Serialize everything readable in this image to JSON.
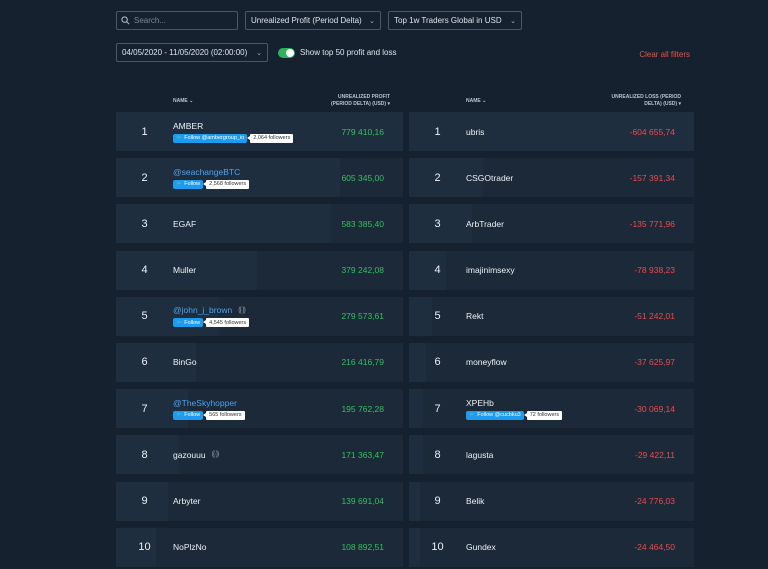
{
  "filters": {
    "search_placeholder": "Search...",
    "metric": "Unrealized Profit (Period Delta)",
    "group": "Top 1w Traders Global in USD",
    "date_range": "04/05/2020 - 11/05/2020 (02:00:00)",
    "toggle_label": "Show top 50 profit and loss",
    "clear_label": "Clear all filters"
  },
  "profit": {
    "col_name": "NAME",
    "col_value_1": "UNREALIZED PROFIT",
    "col_value_2": "(PERIOD DELTA) (USD)",
    "rows": [
      {
        "rank": "1",
        "name": "AMBER",
        "value": "779 410,16",
        "follow": "Follow @ambergroup_io",
        "followers": "2,064 followers",
        "live": "",
        "handle": false,
        "level": 1.0
      },
      {
        "rank": "2",
        "name": "@seachangeBTC",
        "value": "605 345,00",
        "follow": "Follow",
        "followers": "2,568 followers",
        "live": "",
        "handle": true,
        "level": 0.78
      },
      {
        "rank": "3",
        "name": "EGAF",
        "value": "583 385,40",
        "follow": "",
        "followers": "",
        "live": "",
        "handle": false,
        "level": 0.75
      },
      {
        "rank": "4",
        "name": "Muller",
        "value": "379 242,08",
        "follow": "",
        "followers": "",
        "live": "",
        "handle": false,
        "level": 0.49
      },
      {
        "rank": "5",
        "name": "@john_j_brown",
        "value": "279 573,61",
        "follow": "Follow",
        "followers": "4,545 followers",
        "live": "((·))",
        "handle": true,
        "level": 0.36
      },
      {
        "rank": "6",
        "name": "BinGo",
        "value": "216 416,79",
        "follow": "",
        "followers": "",
        "live": "",
        "handle": false,
        "level": 0.28
      },
      {
        "rank": "7",
        "name": "@TheSkyhopper",
        "value": "195 762,28",
        "follow": "Follow",
        "followers": "565 followers",
        "live": "",
        "handle": true,
        "level": 0.25
      },
      {
        "rank": "8",
        "name": "gazouuu",
        "value": "171 363,47",
        "follow": "",
        "followers": "",
        "live": "((·))",
        "handle": false,
        "level": 0.22
      },
      {
        "rank": "9",
        "name": "Arbyter",
        "value": "139 691,04",
        "follow": "",
        "followers": "",
        "live": "",
        "handle": false,
        "level": 0.18
      },
      {
        "rank": "10",
        "name": "NoPlzNo",
        "value": "108 892,51",
        "follow": "",
        "followers": "",
        "live": "",
        "handle": false,
        "level": 0.14
      }
    ]
  },
  "loss": {
    "col_name": "NAME",
    "col_value_1": "UNREALIZED LOSS (PERIOD",
    "col_value_2": "DELTA) (USD)",
    "rows": [
      {
        "rank": "1",
        "name": "ubris",
        "value": "-604 655,74",
        "follow": "",
        "followers": "",
        "live": "",
        "handle": false,
        "level": 1.0
      },
      {
        "rank": "2",
        "name": "CSGOtrader",
        "value": "-157 391,34",
        "follow": "",
        "followers": "",
        "live": "",
        "handle": false,
        "level": 0.26
      },
      {
        "rank": "3",
        "name": "ArbTrader",
        "value": "-135 771,96",
        "follow": "",
        "followers": "",
        "live": "",
        "handle": false,
        "level": 0.22
      },
      {
        "rank": "4",
        "name": "imajinimsexy",
        "value": "-78 938,23",
        "follow": "",
        "followers": "",
        "live": "",
        "handle": false,
        "level": 0.13
      },
      {
        "rank": "5",
        "name": "Rekt",
        "value": "-51 242,01",
        "follow": "",
        "followers": "",
        "live": "",
        "handle": false,
        "level": 0.08
      },
      {
        "rank": "6",
        "name": "moneyflow",
        "value": "-37 625,97",
        "follow": "",
        "followers": "",
        "live": "",
        "handle": false,
        "level": 0.06
      },
      {
        "rank": "7",
        "name": "XPEHb",
        "value": "-30 069,14",
        "follow": "Follow @cucbku3",
        "followers": "72 followers",
        "live": "",
        "handle": false,
        "level": 0.05
      },
      {
        "rank": "8",
        "name": "lagusta",
        "value": "-29 422,11",
        "follow": "",
        "followers": "",
        "live": "",
        "handle": false,
        "level": 0.05
      },
      {
        "rank": "9",
        "name": "Belik",
        "value": "-24 776,03",
        "follow": "",
        "followers": "",
        "live": "",
        "handle": false,
        "level": 0.04
      },
      {
        "rank": "10",
        "name": "Gundex",
        "value": "-24 464,50",
        "follow": "",
        "followers": "",
        "live": "",
        "handle": false,
        "level": 0.04
      }
    ]
  },
  "colors": {
    "profit": "#35c15d",
    "loss": "#ef4a4a",
    "accent": "#2fb35a",
    "twitter": "#1d9bf0"
  }
}
